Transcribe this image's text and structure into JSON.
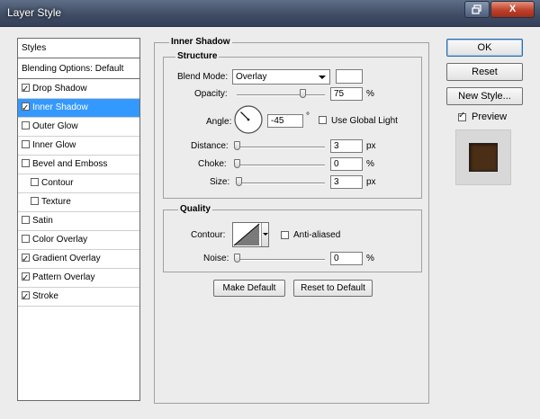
{
  "window": {
    "title": "Layer Style",
    "restore_icon": "restore-icon",
    "close_label": "X"
  },
  "styles_list": {
    "header": "Styles",
    "blending": "Blending Options: Default",
    "items": [
      {
        "label": "Drop Shadow",
        "checked": true
      },
      {
        "label": "Inner Shadow",
        "checked": true,
        "selected": true
      },
      {
        "label": "Outer Glow",
        "checked": false
      },
      {
        "label": "Inner Glow",
        "checked": false
      },
      {
        "label": "Bevel and Emboss",
        "checked": false
      },
      {
        "label": "Contour",
        "checked": false
      },
      {
        "label": "Texture",
        "checked": false
      },
      {
        "label": "Satin",
        "checked": false
      },
      {
        "label": "Color Overlay",
        "checked": false
      },
      {
        "label": "Gradient Overlay",
        "checked": true
      },
      {
        "label": "Pattern Overlay",
        "checked": true
      },
      {
        "label": "Stroke",
        "checked": true
      }
    ]
  },
  "inner_shadow": {
    "title": "Inner Shadow",
    "structure": {
      "title": "Structure",
      "blend_mode_label": "Blend Mode:",
      "blend_mode_value": "Overlay",
      "opacity_label": "Opacity:",
      "opacity_value": "75",
      "opacity_fraction": 0.75,
      "percent": "%",
      "angle_label": "Angle:",
      "angle_value": "-45",
      "angle_degrees": -45,
      "degree_symbol": "°",
      "use_global_light_label": "Use Global Light",
      "distance_label": "Distance:",
      "distance_value": "3",
      "px": "px",
      "choke_label": "Choke:",
      "choke_value": "0",
      "size_label": "Size:",
      "size_value": "3"
    },
    "quality": {
      "title": "Quality",
      "contour_label": "Contour:",
      "anti_aliased_label": "Anti-aliased",
      "noise_label": "Noise:",
      "noise_value": "0"
    },
    "make_default_label": "Make Default",
    "reset_default_label": "Reset to Default"
  },
  "right_panel": {
    "ok_label": "OK",
    "reset_label": "Reset",
    "new_style_label": "New Style...",
    "preview_label": "Preview",
    "preview_checked": true
  },
  "colors": {
    "selection": "#3399ff",
    "preview_swatch": "#4a2e16"
  }
}
